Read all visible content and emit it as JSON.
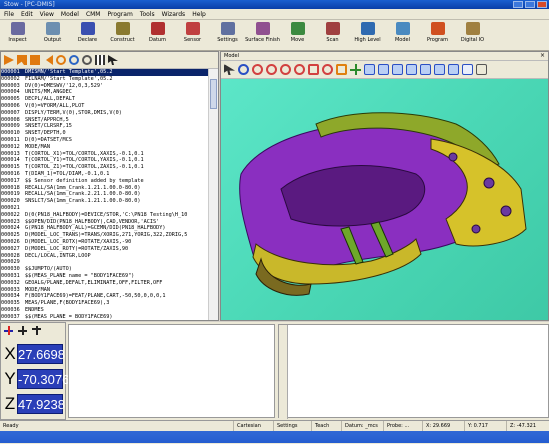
{
  "window": {
    "title": "Stow - [PC-DMIS]"
  },
  "menu": [
    "File",
    "Edit",
    "View",
    "Model",
    "CMM",
    "Program",
    "Tools",
    "Wizards",
    "Help"
  ],
  "toolbar": [
    {
      "label": "Inspect",
      "icon": "inspect-icon",
      "color": "#6a6aa0"
    },
    {
      "label": "Output",
      "icon": "output-icon",
      "color": "#6d8fb0"
    },
    {
      "label": "Declare",
      "icon": "declare-icon",
      "color": "#3a4fb0"
    },
    {
      "label": "Construct",
      "icon": "construct-icon",
      "color": "#8a7a30"
    },
    {
      "label": "Datum",
      "icon": "datum-icon",
      "color": "#b03030"
    },
    {
      "label": "Sensor",
      "icon": "sensor-icon",
      "color": "#c04040"
    },
    {
      "label": "Settings",
      "icon": "settings-icon",
      "color": "#6070a0"
    },
    {
      "label": "Surface Finish",
      "icon": "surface-finish-icon",
      "color": "#905090"
    },
    {
      "label": "Move",
      "icon": "move-icon",
      "color": "#3c8a40"
    },
    {
      "label": "Scan",
      "icon": "scan-icon",
      "color": "#a04040"
    },
    {
      "label": "High Level",
      "icon": "high-level-icon",
      "color": "#2f6ab0"
    },
    {
      "label": "Model",
      "icon": "model-icon",
      "color": "#4a8ac0"
    },
    {
      "label": "Program",
      "icon": "program-icon",
      "color": "#d05020"
    },
    {
      "label": "Digital IO",
      "icon": "digital-io-icon",
      "color": "#a08040"
    }
  ],
  "model_title": "Model",
  "code": [
    {
      "n": "000001",
      "t": "DMISMN/'Start Template',05.2",
      "sel": true
    },
    {
      "n": "000002",
      "t": "FILNAM/'Start Template',05.2"
    },
    {
      "n": "000003",
      "t": "DV(0)=DMESWV/'12,0,3,529'"
    },
    {
      "n": "000004",
      "t": "UNITS/MM,ANGDEC"
    },
    {
      "n": "000005",
      "t": "DECPL/ALL,DEFALT"
    },
    {
      "n": "000006",
      "t": "V(0)=VFORM/ALL,PLOT"
    },
    {
      "n": "000007",
      "t": "DISPLY/TERM,V(0),STOR,DMIS,V(0)"
    },
    {
      "n": "000008",
      "t": "SNSET/APPRCH,5"
    },
    {
      "n": "000009",
      "t": "SNSET/CLRSRF,15"
    },
    {
      "n": "000010",
      "t": "SNSET/DEPTH,0"
    },
    {
      "n": "000011",
      "t": "D(0)=DATSET/MCS"
    },
    {
      "n": "000012",
      "t": "MODE/MAN"
    },
    {
      "n": "000013",
      "t": "T(CORTOL_X1)=TOL/CORTOL,XAXIS,-0.1,0.1"
    },
    {
      "n": "000014",
      "t": "T(CORTOL_Y1)=TOL/CORTOL,YAXIS,-0.1,0.1"
    },
    {
      "n": "000015",
      "t": "T(CORTOL_Z1)=TOL/CORTOL,ZAXIS,-0.1,0.1"
    },
    {
      "n": "000016",
      "t": "T(DIAM_1)=TOL/DIAM,-0.1,0.1"
    },
    {
      "n": "000017",
      "t": "$$ Sensor definition added by template"
    },
    {
      "n": "000018",
      "t": "RECALL/SA(1mm_Crank.1.21.1.00.0-80.0)"
    },
    {
      "n": "000019",
      "t": "RECALL/SA(1mm_Crank.2.21.1.00.0-80.0)"
    },
    {
      "n": "000020",
      "t": "SNSLCT/SA(1mm_Crank.1.21.1.00.0-80.0)"
    },
    {
      "n": "000021",
      "t": ""
    },
    {
      "n": "000022",
      "t": "D(0(PN18_HALFBODY)=DEVICE/STOR,'C:\\PN18 Testing\\H_10"
    },
    {
      "n": "000023",
      "t": "$$OPEN/DID(PN18_HALFBODY),CAD,VENDOR,'ACIS'"
    },
    {
      "n": "000024",
      "t": "G(PN18_HALFBODY_ALL)=GCEMN/DID(PN18_HALFBODY)"
    },
    {
      "n": "000025",
      "t": "D(MODEL_LOC_TRANS)=TRANS/XORIG,271,YORIG,322,ZORIG,5"
    },
    {
      "n": "000026",
      "t": "D(MODEL_LOC_ROTX)=ROTATE/XAXIS,-90"
    },
    {
      "n": "000027",
      "t": "D(MODEL_LOC_ROTY)=ROTATE/ZAXIS,90"
    },
    {
      "n": "000028",
      "t": "DECL/LOCAL,INTGR,LOOP"
    },
    {
      "n": "000029",
      "t": ""
    },
    {
      "n": "000030",
      "t": "$$JUMPTO/(AUTO)"
    },
    {
      "n": "000031",
      "t": "$$(MEAS_PLANE name = \"BODY1FACE69\")"
    },
    {
      "n": "000032",
      "t": "GEOALG/PLANE,DEFALT,ELIMINATE,OFF,FILTER,OFF"
    },
    {
      "n": "000033",
      "t": "MODE/MAN"
    },
    {
      "n": "000034",
      "t": "F(BODY1FACE69)=FEAT/PLANE,CART,-50,50,0,0,0,1"
    },
    {
      "n": "000035",
      "t": "MEAS/PLANE,F(BODY1FACE69),3"
    },
    {
      "n": "000036",
      "t": "ENDMES"
    },
    {
      "n": "000037",
      "t": "$$(MEAS_PLANE = BODY1FACE69)"
    }
  ],
  "dro": {
    "x_label": "X",
    "y_label": "Y",
    "z_label": "Z",
    "x": "27.6698",
    "y": "-70.3076",
    "z": "47.9238"
  },
  "status": {
    "ready": "Ready",
    "mode": "Cartesian",
    "settings": "Settings",
    "teach": "Teach",
    "datum": "Datum: _mcs",
    "probe": "Probe: ...",
    "x": "X: 29.669",
    "y": "Y: 0.717",
    "z": "Z: -47.321"
  }
}
